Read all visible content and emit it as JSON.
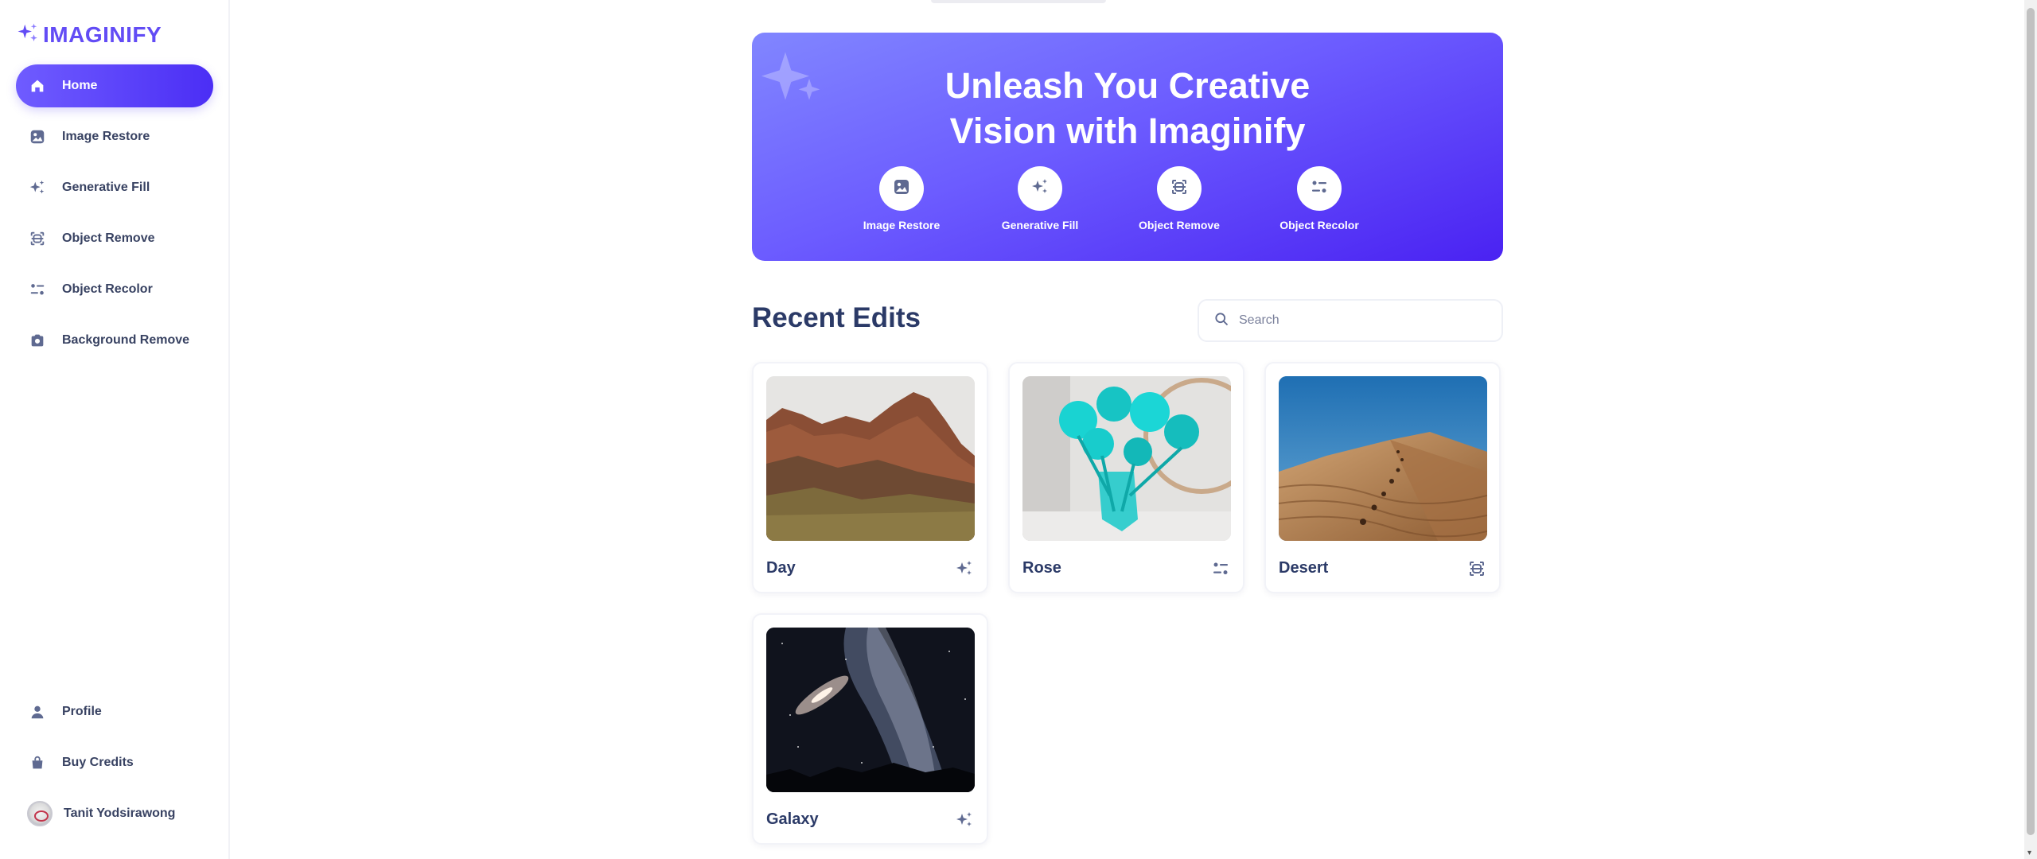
{
  "app": {
    "name": "IMAGINIFY",
    "brand_color": "#624cf5",
    "accent_gradient": [
      "#6f5cff",
      "#4b2ef5"
    ]
  },
  "sidebar": {
    "items": [
      {
        "label": "Home",
        "icon": "home-icon",
        "active": true
      },
      {
        "label": "Image Restore",
        "icon": "image-icon",
        "active": false
      },
      {
        "label": "Generative Fill",
        "icon": "sparkles-icon",
        "active": false
      },
      {
        "label": "Object Remove",
        "icon": "scan-icon",
        "active": false
      },
      {
        "label": "Object Recolor",
        "icon": "filter-icon",
        "active": false
      },
      {
        "label": "Background Remove",
        "icon": "camera-icon",
        "active": false
      }
    ],
    "bottom_items": [
      {
        "label": "Profile",
        "icon": "user-icon"
      },
      {
        "label": "Buy Credits",
        "icon": "bag-icon"
      }
    ],
    "user": {
      "name": "Tanit Yodsirawong"
    }
  },
  "banner": {
    "title_line1": "Unleash You Creative",
    "title_line2": "Vision with Imaginify",
    "tools": [
      {
        "label": "Image Restore",
        "icon": "image-icon"
      },
      {
        "label": "Generative Fill",
        "icon": "sparkles-icon"
      },
      {
        "label": "Object Remove",
        "icon": "scan-icon"
      },
      {
        "label": "Object Recolor",
        "icon": "filter-icon"
      }
    ]
  },
  "recent": {
    "title": "Recent Edits",
    "search_placeholder": "Search",
    "cards": [
      {
        "title": "Day",
        "icon": "sparkles-icon",
        "image": "canyon cliffs under overcast sky"
      },
      {
        "title": "Rose",
        "icon": "filter-icon",
        "image": "cyan roses in glass vase"
      },
      {
        "title": "Desert",
        "icon": "scan-icon",
        "image": "sand dune with footprints under blue sky"
      },
      {
        "title": "Galaxy",
        "icon": "sparkles-icon",
        "image": "milky way and galaxy over mountains"
      }
    ]
  }
}
